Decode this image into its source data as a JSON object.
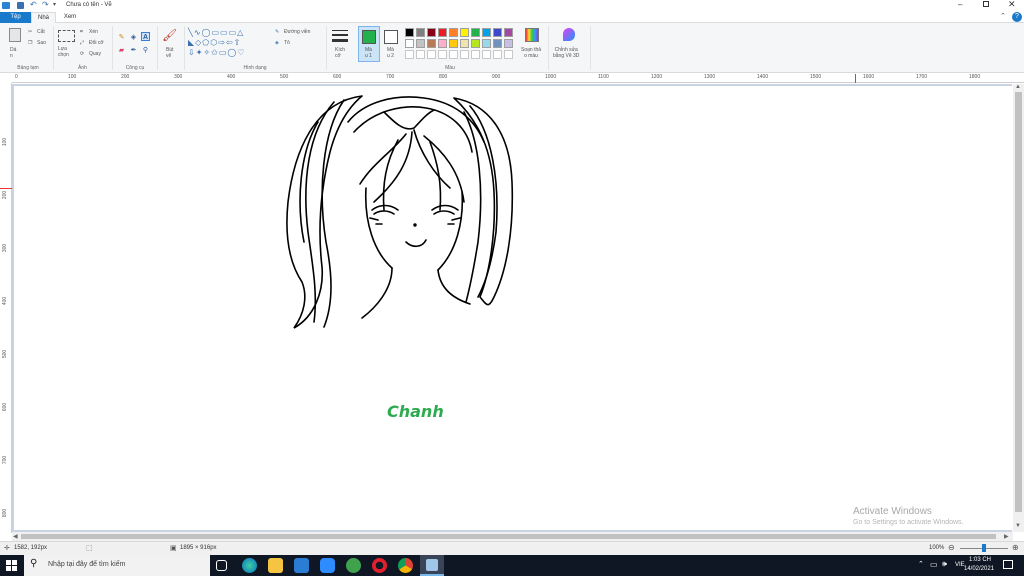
{
  "window": {
    "title": "Chưa có tên - Vẽ",
    "controls": [
      "minimize-icon",
      "restore-icon",
      "close-icon"
    ]
  },
  "tabs": [
    {
      "label": "Tệp",
      "active": true
    },
    {
      "label": "Nhà"
    },
    {
      "label": "Xem"
    }
  ],
  "ribbon": {
    "clipboard": {
      "paste": "Dá\nn",
      "cut": "Cắt",
      "copy": "Sao",
      "group": "Bảng tạm"
    },
    "image": {
      "select": "Lựa\nchọn",
      "crop": "Xén",
      "resize": "Đổi cỡ",
      "rotate": "Quay",
      "group": "Ảnh"
    },
    "tools": {
      "group": "Công cụ"
    },
    "brushes": {
      "label": "Bút\nvẽ"
    },
    "shapes": {
      "outline": "Đường viền",
      "fill": "Tô",
      "group": "Hình dạng"
    },
    "size": {
      "label": "Kích\ncỡ"
    },
    "color1": {
      "label": "Mà\nu 1",
      "value": "#22b14c"
    },
    "color2": {
      "label": "Mà\nu 2",
      "value": "#ffffff"
    },
    "edit_colors": "Soạn thả\no màu",
    "paint3d": "Chỉnh sửa\nbằng Vẽ 3D",
    "colors_group": "Màu",
    "palette": [
      "#000000",
      "#7f7f7f",
      "#880015",
      "#ed1c24",
      "#ff7f27",
      "#fff200",
      "#22b14c",
      "#00a2e8",
      "#3f48cc",
      "#a349a4",
      "#ffffff",
      "#c3c3c3",
      "#b97a57",
      "#ffaec9",
      "#ffc90e",
      "#efe4b0",
      "#b5e61d",
      "#99d9ea",
      "#7092be",
      "#c8bfe7"
    ]
  },
  "ruler": {
    "h_marks": [
      "0",
      "100",
      "200",
      "300",
      "400",
      "500",
      "600",
      "700",
      "800",
      "900",
      "1000",
      "1100",
      "1200",
      "1300",
      "1400",
      "1500",
      "1600",
      "1700",
      "1800"
    ],
    "v_marks": [
      "100",
      "200",
      "300",
      "400",
      "500",
      "600",
      "700",
      "800"
    ]
  },
  "canvas": {
    "text": "Chanh",
    "text_color": "#2eaa4f"
  },
  "watermark": {
    "title": "Activate Windows",
    "subtitle": "Go to Settings to activate Windows."
  },
  "status": {
    "cursor": "1582, 192px",
    "size": "1895 × 916px",
    "zoom": "100%"
  },
  "taskbar": {
    "search_placeholder": "Nhập tại đây để tìm kiếm",
    "language": "VIE",
    "time": "1:03 CH",
    "date": "14/02/2021"
  }
}
